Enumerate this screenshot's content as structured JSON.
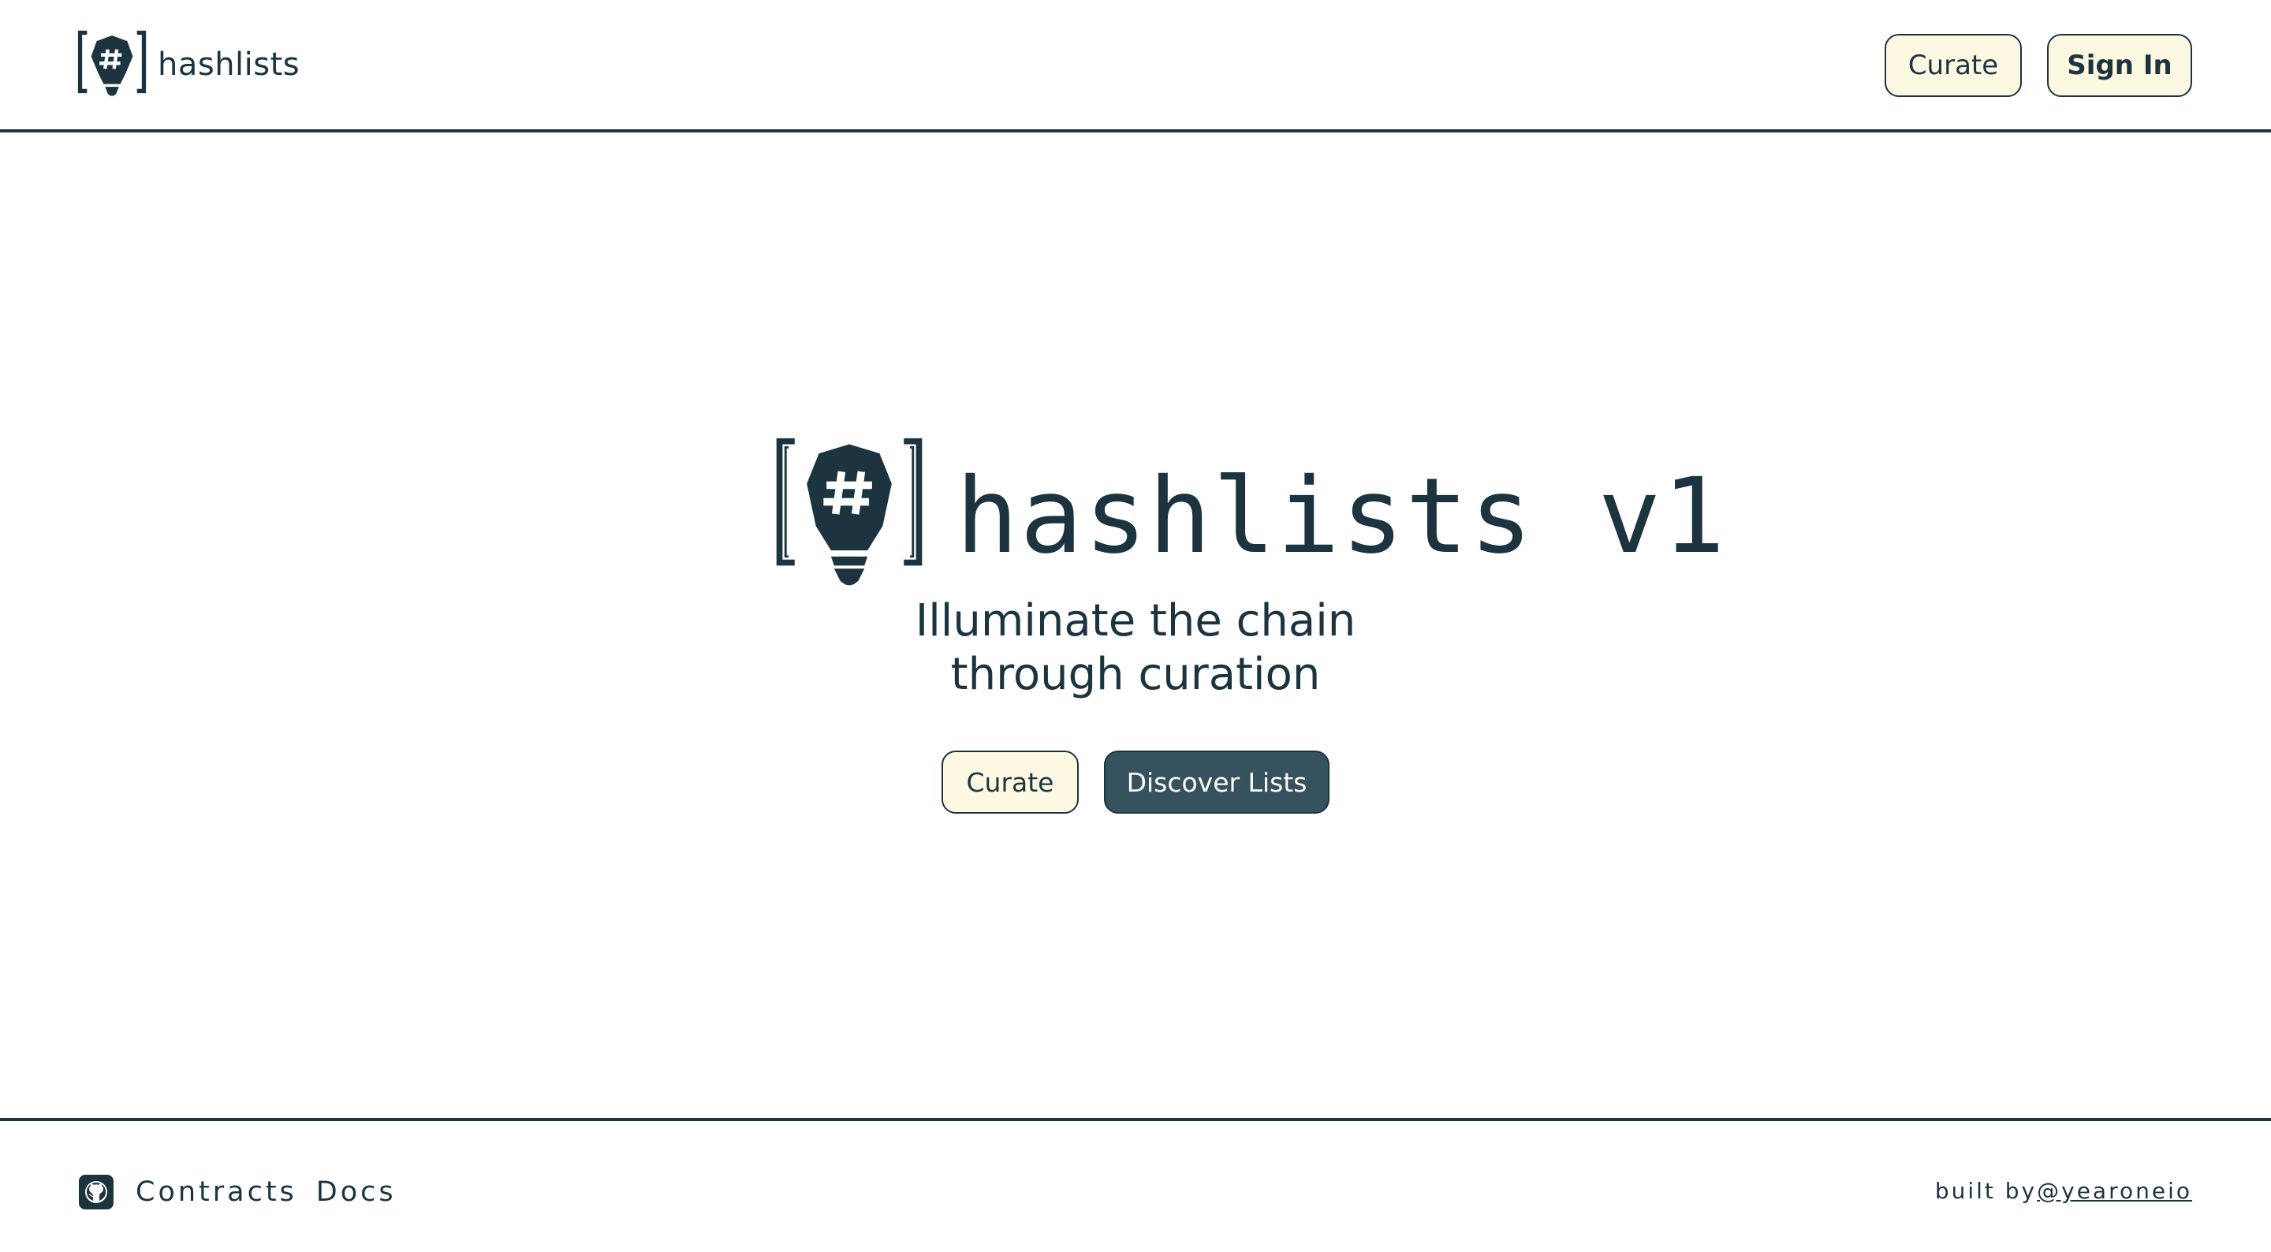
{
  "header": {
    "brand_name": "hashlists",
    "curate_label": "Curate",
    "signin_label": "Sign In"
  },
  "hero": {
    "title": "hashlists v1",
    "tagline_line1": "Illuminate the chain",
    "tagline_line2": "through curation",
    "curate_label": "Curate",
    "discover_label": "Discover Lists"
  },
  "footer": {
    "contracts_label": "Contracts",
    "docs_label": "Docs",
    "built_by_prefix": "built by",
    "built_by_handle": "@yearoneio"
  },
  "icons": {
    "brand": "bracketed-hash-lightbulb-icon",
    "github": "github-icon"
  },
  "colors": {
    "primary": "#1b3440",
    "button_light": "#fdf8e1",
    "button_dark": "#36525f",
    "background": "#ffffff"
  }
}
